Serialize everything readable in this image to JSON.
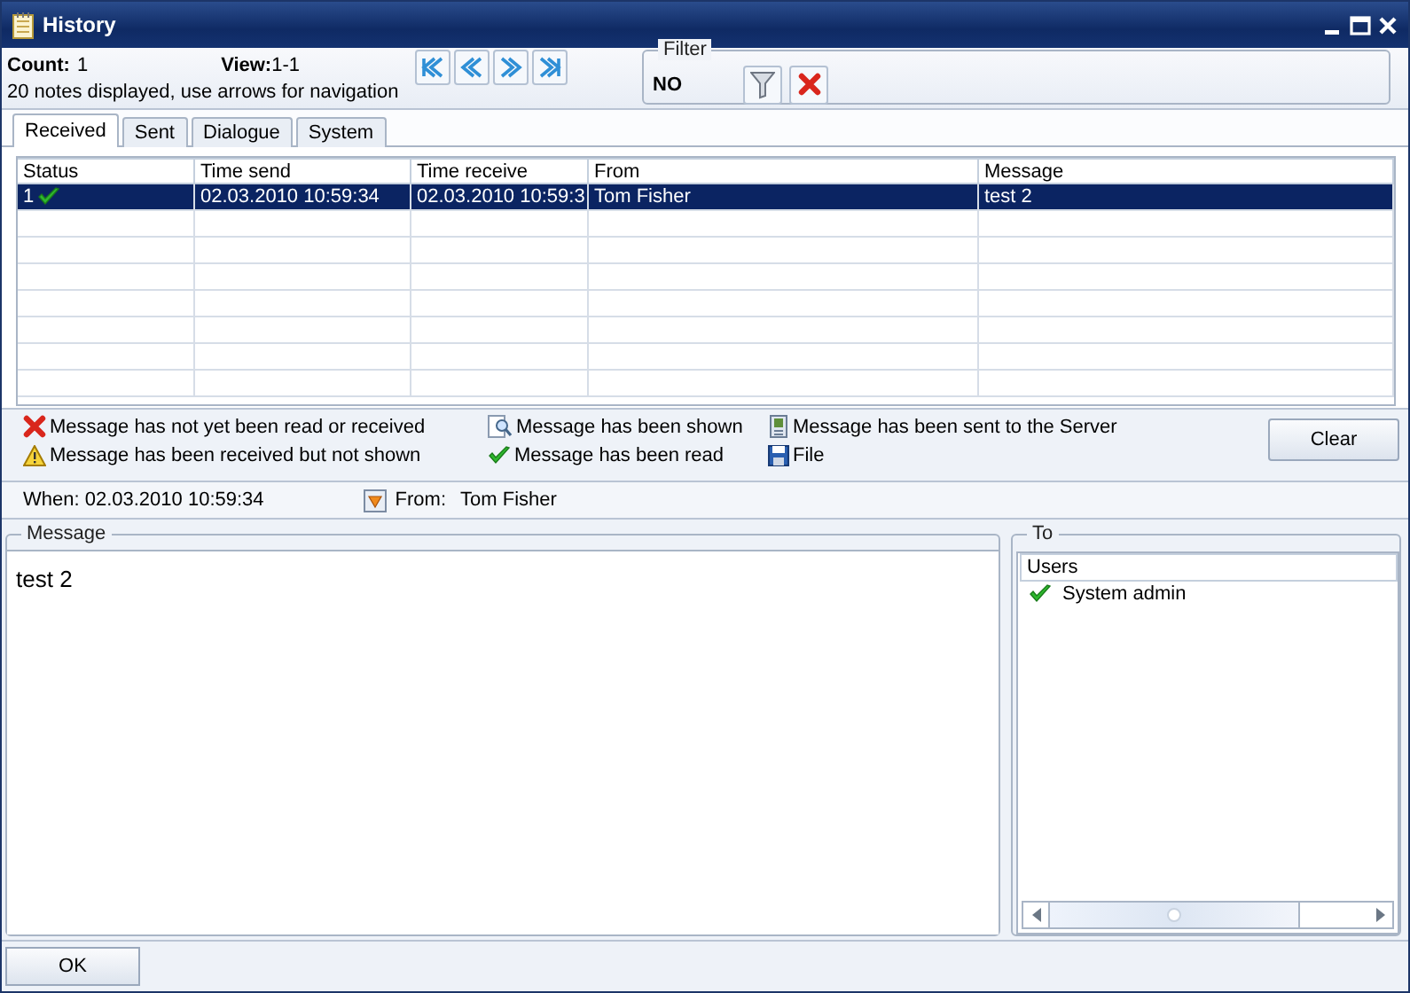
{
  "window": {
    "title": "History"
  },
  "header": {
    "count_label": "Count:",
    "count": "1",
    "view_label": "View:",
    "view": "1-1",
    "hint": "20 notes displayed, use arrows for navigation"
  },
  "filter": {
    "label": "Filter",
    "value": "NO"
  },
  "tabs": [
    {
      "label": "Received",
      "selected": true
    },
    {
      "label": "Sent",
      "selected": false
    },
    {
      "label": "Dialogue",
      "selected": false
    },
    {
      "label": "System",
      "selected": false
    }
  ],
  "table": {
    "columns": [
      "Status",
      "Time send",
      "Time receive",
      "From",
      "Message"
    ],
    "rows": [
      {
        "number": "1",
        "kind": "read",
        "time_send": "02.03.2010 10:59:34",
        "time_receive": "02.03.2010 10:59:3",
        "from": "Tom Fisher",
        "message": "test 2",
        "selected": true
      }
    ]
  },
  "legend": [
    {
      "kind": "not_read",
      "text": "Message has not yet been read or received"
    },
    {
      "kind": "not_shown",
      "text": "Message has been received but not shown"
    },
    {
      "kind": "shown",
      "text": "Message has been shown"
    },
    {
      "kind": "read",
      "text": "Message has been read"
    },
    {
      "kind": "sent",
      "text": "Message has been sent to the Server"
    },
    {
      "kind": "file",
      "text": "File"
    }
  ],
  "clear_button": "Clear",
  "details": {
    "when_label": "When:",
    "when": "02.03.2010 10:59:34",
    "from_label": "From:",
    "from": "Tom Fisher"
  },
  "message": {
    "label": "Message",
    "text": "test 2"
  },
  "recipients": {
    "label": "To",
    "column": "Users",
    "users": [
      {
        "name": "System admin",
        "kind": "read"
      }
    ]
  },
  "ok_button": "OK"
}
